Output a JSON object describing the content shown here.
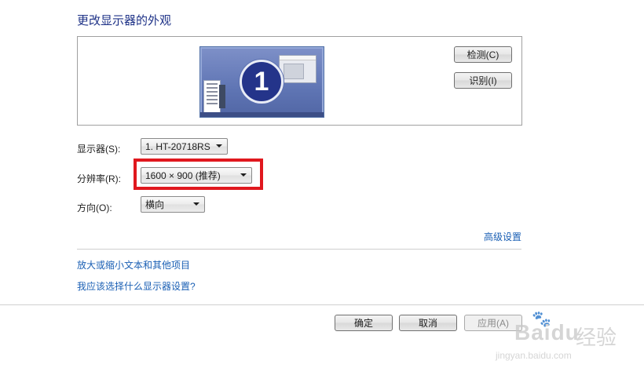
{
  "page": {
    "title": "更改显示器的外观"
  },
  "preview": {
    "monitor_number": "1"
  },
  "buttons": {
    "detect": "检测(C)",
    "identify": "识别(I)",
    "ok": "确定",
    "cancel": "取消",
    "apply": "应用(A)"
  },
  "fields": {
    "display": {
      "label": "显示器(S):",
      "value": "1. HT-20718RS"
    },
    "resolution": {
      "label": "分辨率(R):",
      "value": "1600 × 900 (推荐)"
    },
    "orientation": {
      "label": "方向(O):",
      "value": "横向"
    }
  },
  "links": {
    "advanced": "高级设置",
    "text_size": "放大或缩小文本和其他项目",
    "which_settings": "我应该选择什么显示器设置?"
  },
  "watermark": {
    "brand": "Bai",
    "brand2": "du",
    "cn": "经验",
    "url": "jingyan.baidu.com"
  },
  "colors": {
    "highlight": "#e0181e",
    "link": "#1a5fb4",
    "title": "#1e3287"
  }
}
